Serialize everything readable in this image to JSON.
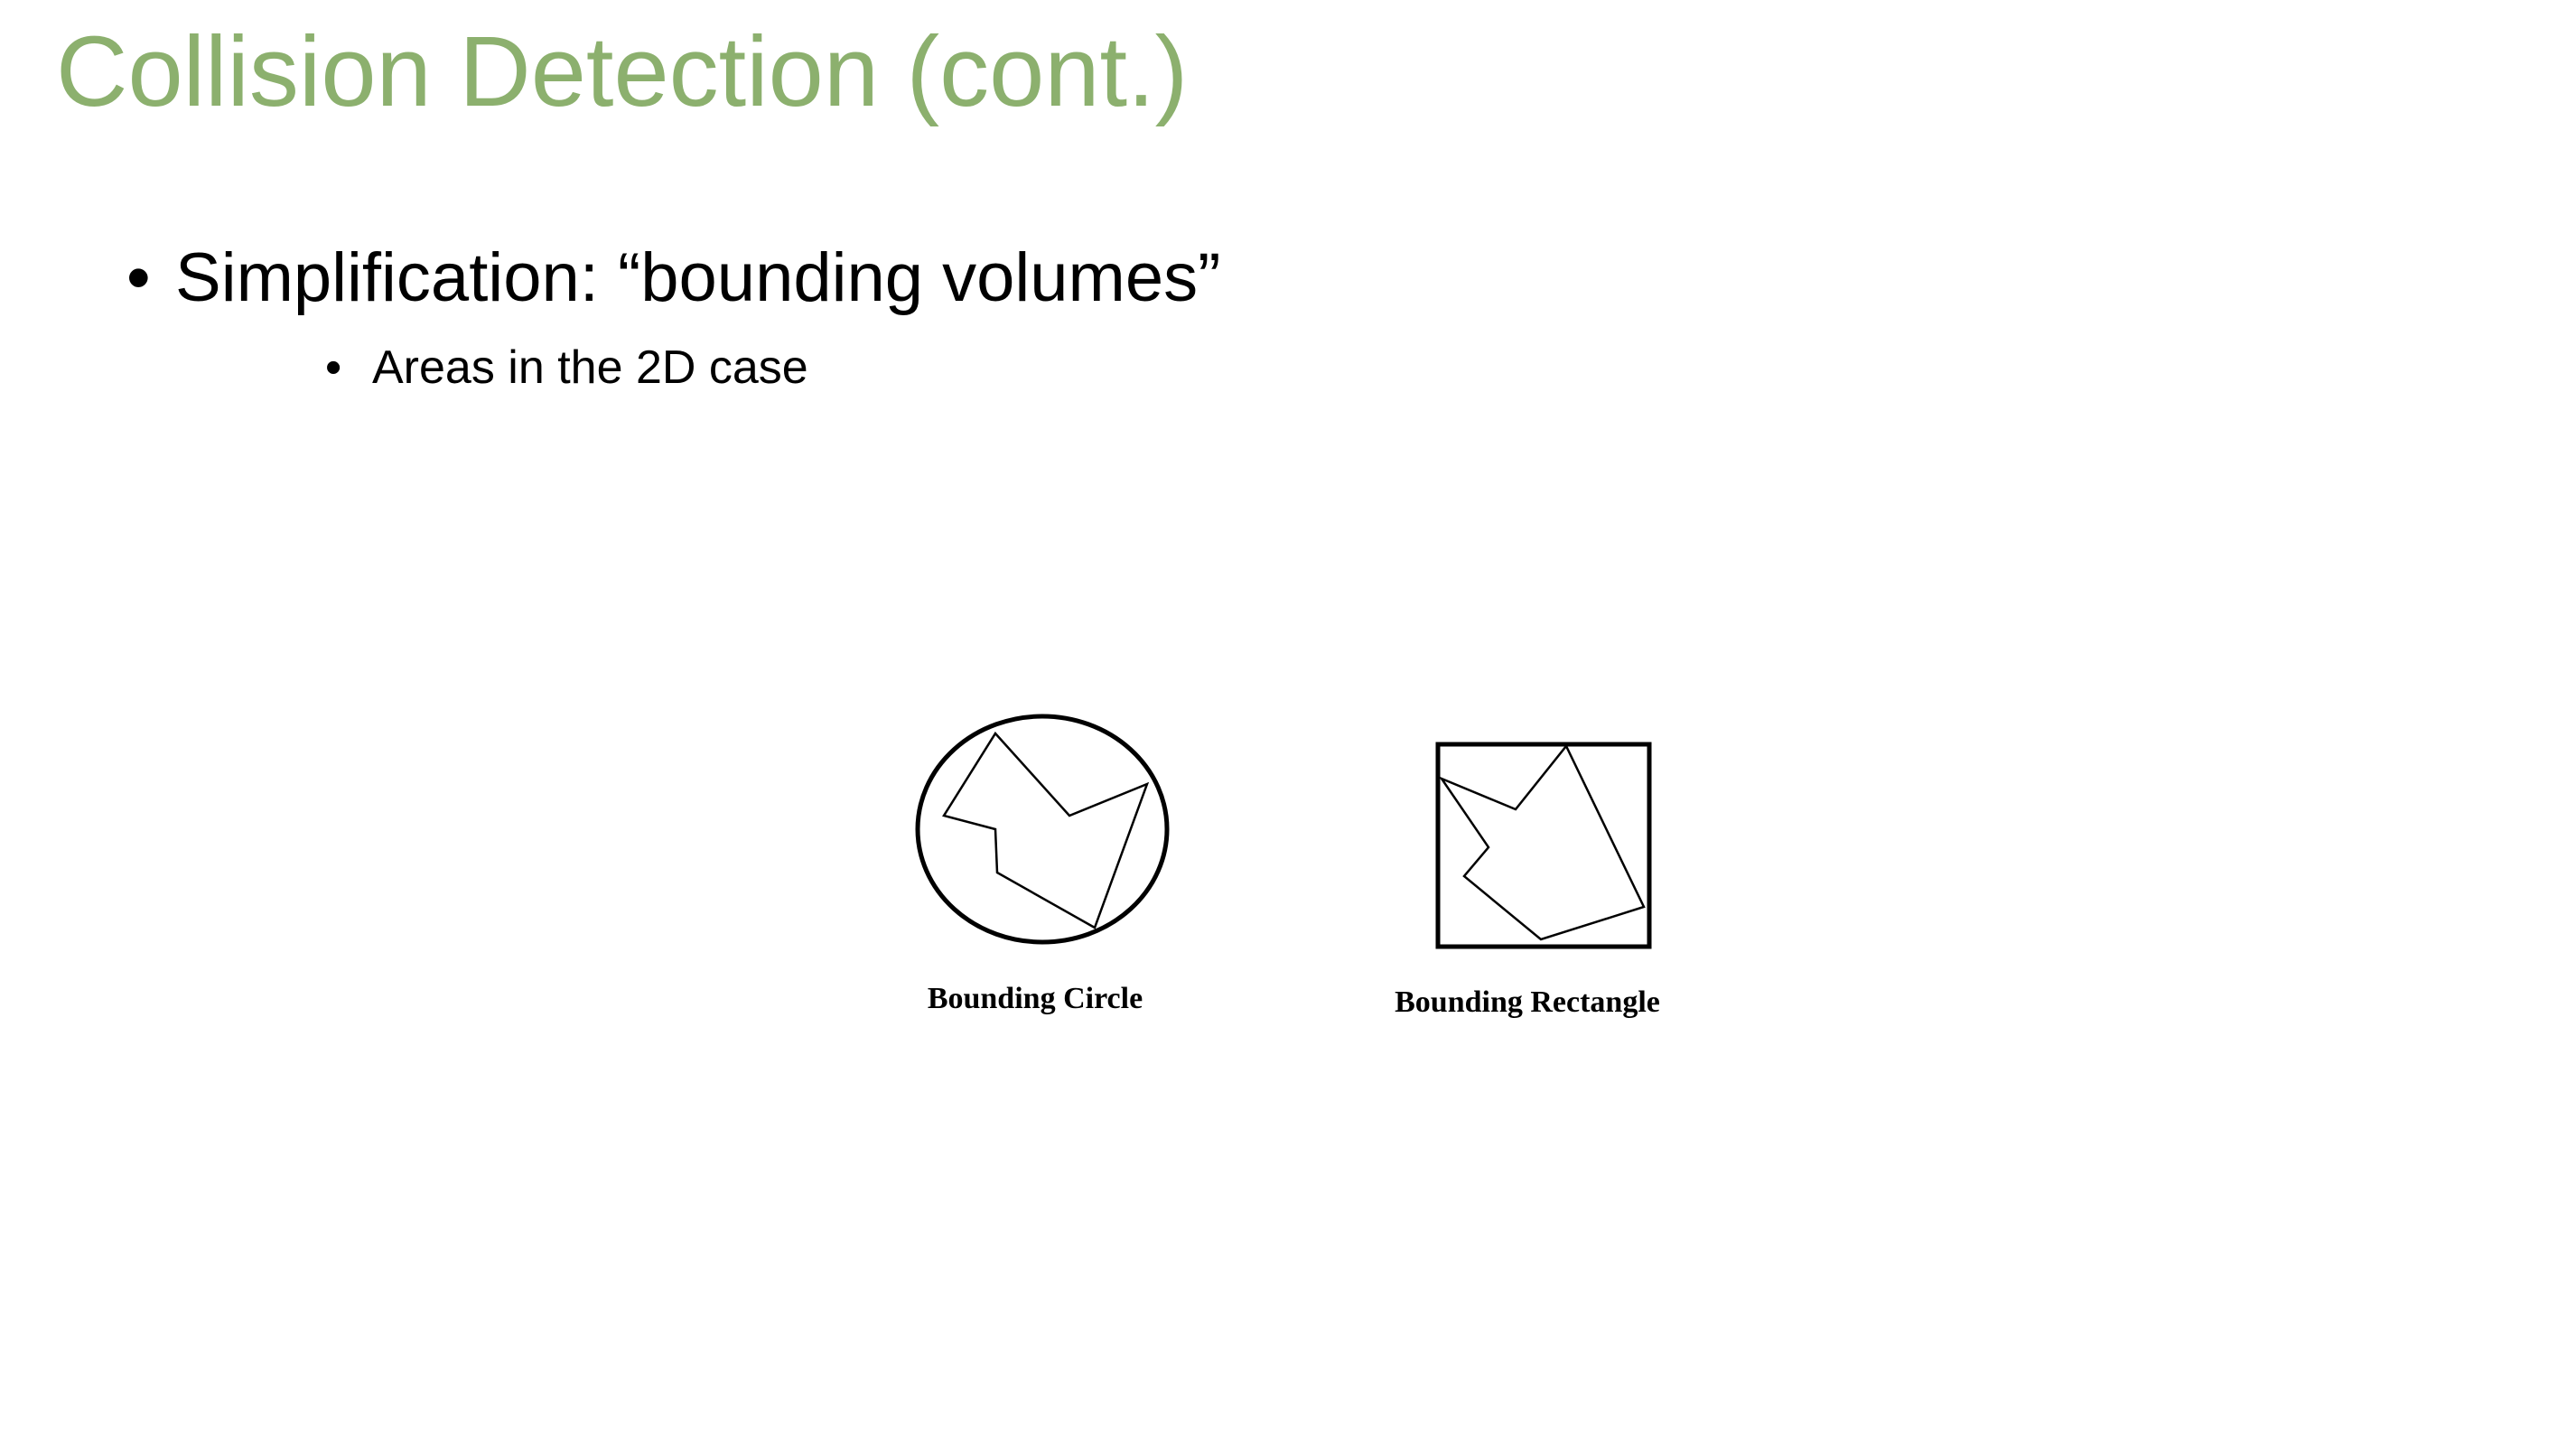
{
  "slide": {
    "title": "Collision Detection (cont.)",
    "title_color": "#8cb06e",
    "bullets": [
      {
        "marker": "•",
        "text": "Simplification:  “bounding volumes”",
        "sub_bullets": [
          {
            "marker": "•",
            "text": "Areas in the 2D case"
          }
        ]
      }
    ]
  },
  "figure": {
    "stroke_color": "#000000",
    "items": [
      {
        "shape": "circle",
        "label": "Bounding Circle"
      },
      {
        "shape": "rectangle",
        "label": "Bounding Rectangle"
      }
    ]
  }
}
